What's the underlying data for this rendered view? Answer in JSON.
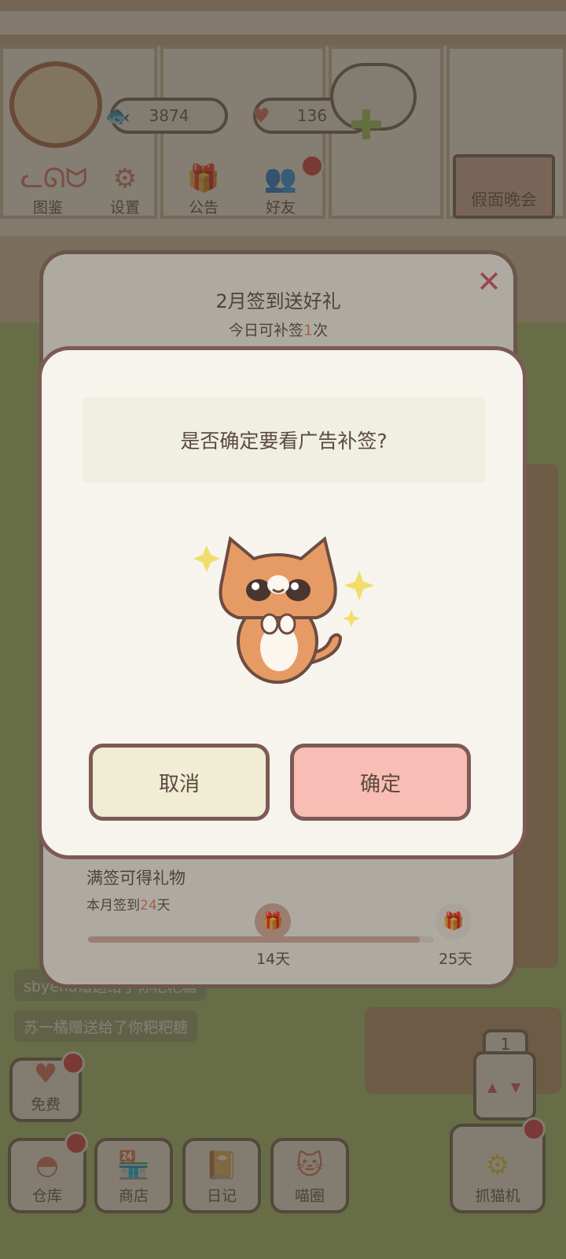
{
  "top_bar": {
    "fish_count": "3874",
    "heart_count": "136"
  },
  "nav": {
    "items": [
      {
        "label": "图鉴",
        "icon": "cat-face-icon"
      },
      {
        "label": "设置",
        "icon": "gear-icon"
      },
      {
        "label": "公告",
        "icon": "gift-icon"
      },
      {
        "label": "好友",
        "icon": "friends-icon"
      }
    ]
  },
  "event_banner": {
    "label": "假面晚会"
  },
  "chat": {
    "lines": [
      "sbyeha赠送给了你粑粑糖",
      "苏一橘赠送给了你粑粑糖"
    ]
  },
  "left_buttons": {
    "free": "免费",
    "warehouse": "仓库",
    "shop": "商店",
    "diary": "日记",
    "meow_circle": "喵圈"
  },
  "right_buttons": {
    "floor_number": "1",
    "claw_machine": "抓猫机"
  },
  "signin": {
    "title": "2月签到送好礼",
    "sub_prefix": "今日可补签",
    "sub_count": "1",
    "sub_suffix": "次",
    "reward_title": "满签可得礼物",
    "month_prefix": "本月签到",
    "month_days": "24",
    "month_suffix": "天",
    "progress": 0.96,
    "milestones": [
      "14天",
      "25天"
    ]
  },
  "dialog": {
    "question": "是否确定要看广告补签?",
    "cancel_label": "取消",
    "confirm_label": "确定"
  },
  "colors": {
    "accent_red": "#d6333b",
    "highlight_orange": "#e57a61",
    "dialog_border": "#7d5a55"
  }
}
